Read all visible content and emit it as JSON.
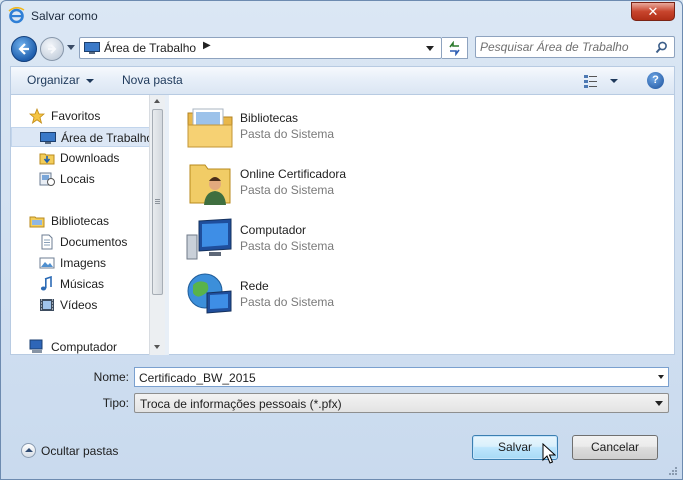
{
  "window": {
    "title": "Salvar como",
    "close_label": "✕"
  },
  "address_bar": {
    "crumb": "Área de Trabalho",
    "crumb_separator": "▶",
    "search_placeholder": "Pesquisar Área de Trabalho"
  },
  "toolbar": {
    "organize_label": "Organizar",
    "new_folder_label": "Nova pasta",
    "help_label": "?"
  },
  "sidebar": {
    "items": [
      {
        "label": "Favoritos",
        "icon": "star-icon"
      },
      {
        "label": "Área de Trabalho",
        "icon": "desktop-icon",
        "selected": true
      },
      {
        "label": "Downloads",
        "icon": "downloads-icon"
      },
      {
        "label": "Locais",
        "icon": "recent-places-icon"
      },
      {
        "label": "Bibliotecas",
        "icon": "libraries-icon"
      },
      {
        "label": "Documentos",
        "icon": "documents-icon"
      },
      {
        "label": "Imagens",
        "icon": "pictures-icon"
      },
      {
        "label": "Músicas",
        "icon": "music-icon"
      },
      {
        "label": "Vídeos",
        "icon": "videos-icon"
      },
      {
        "label": "Computador",
        "icon": "computer-icon"
      }
    ]
  },
  "content": {
    "items": [
      {
        "name": "Bibliotecas",
        "subtitle": "Pasta do Sistema",
        "icon": "libraries-folder-icon"
      },
      {
        "name": "Online Certificadora",
        "subtitle": "Pasta do Sistema",
        "icon": "user-folder-icon"
      },
      {
        "name": "Computador",
        "subtitle": "Pasta do Sistema",
        "icon": "computer-icon"
      },
      {
        "name": "Rede",
        "subtitle": "Pasta do Sistema",
        "icon": "network-icon"
      }
    ]
  },
  "form": {
    "name_label": "Nome:",
    "name_value": "Certificado_BW_2015",
    "type_label": "Tipo:",
    "type_value": "Troca de informações pessoais (*.pfx)"
  },
  "footer": {
    "hide_folders_label": "Ocultar pastas",
    "save_label": "Salvar",
    "cancel_label": "Cancelar"
  }
}
